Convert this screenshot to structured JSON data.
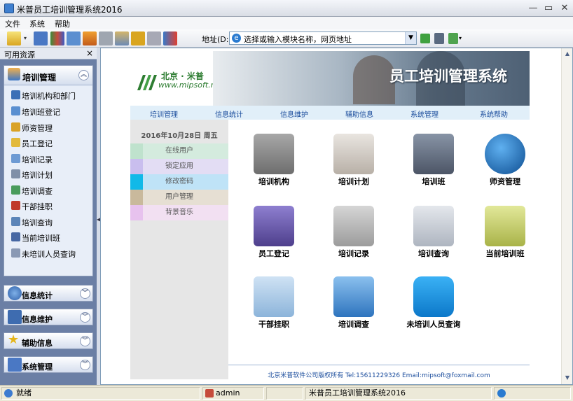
{
  "window": {
    "title": "米普员工培训管理系统2016",
    "minimize": "—",
    "restore": "▭",
    "close": "✕"
  },
  "menu": [
    "文件",
    "系统",
    "帮助"
  ],
  "toolbar": {
    "address_label": "地址(D:)",
    "address_value": "选择或输入模块名称，网页地址",
    "buttons": [
      "open-folder-icon",
      "list-view-icon",
      "books-icon",
      "data-icon",
      "home-icon",
      "print-icon",
      "tools-icon",
      "lock-icon",
      "user-lock-icon",
      "exit-icon"
    ]
  },
  "sidebar": {
    "title": "可用资源",
    "close": "×",
    "panel": {
      "label": "培训管理",
      "items": [
        {
          "label": "培训机构和部门",
          "color": "#3B6FB6"
        },
        {
          "label": "培训班登记",
          "color": "#5A8FD0"
        },
        {
          "label": "师资管理",
          "color": "#D9A227"
        },
        {
          "label": "员工登记",
          "color": "#E2B93B"
        },
        {
          "label": "培训记录",
          "color": "#6D9AD3"
        },
        {
          "label": "培训计划",
          "color": "#7F8FA8"
        },
        {
          "label": "培训调查",
          "color": "#4A9C5C"
        },
        {
          "label": "干部挂职",
          "color": "#C0392B"
        },
        {
          "label": "培训查询",
          "color": "#5B84B8"
        },
        {
          "label": "当前培训班",
          "color": "#4667A3"
        },
        {
          "label": "未培训人员查询",
          "color": "#8A99B4"
        }
      ]
    },
    "groups": [
      {
        "label": "信息统计",
        "color": "#4C7AC0"
      },
      {
        "label": "信息维护",
        "color": "#3E6CB0"
      },
      {
        "label": "辅助信息",
        "color": "#E5B51A"
      },
      {
        "label": "系统管理",
        "color": "#4A78C4"
      }
    ]
  },
  "banner": {
    "company_cn": "北京 · 米普",
    "company_url": "www.mipsoft.net",
    "system_title": "员工培训管理系统"
  },
  "topnav": [
    "培训管理",
    "信息统计",
    "信息维护",
    "辅助信息",
    "系统管理",
    "系统帮助"
  ],
  "leftcol": {
    "date": "2016年10月28日  周五",
    "buttons": [
      {
        "label": "在线用户",
        "bg": "#D4EBDE",
        "strip": "#BFE2CD"
      },
      {
        "label": "锁定应用",
        "bg": "#E3DDF4",
        "strip": "#C9BEEE"
      },
      {
        "label": "修改密码",
        "bg": "#BFE3F7",
        "strip": "#11B9E8"
      },
      {
        "label": "用户管理",
        "bg": "#E6DFD3",
        "strip": "#C9B99C"
      },
      {
        "label": "背景音乐",
        "bg": "#F2E0F2",
        "strip": "#E7C2EE"
      }
    ]
  },
  "tiles": [
    {
      "label": "培训机构",
      "icon": "home-folder-icon",
      "color": "#8C8C8C"
    },
    {
      "label": "培训计划",
      "icon": "calendar-clock-icon",
      "color": "#C9C3BC"
    },
    {
      "label": "培训班",
      "icon": "adobe-folder-icon",
      "color": "#5E6878"
    },
    {
      "label": "师资管理",
      "icon": "users-globe-icon",
      "color": "#1E6FB8"
    },
    {
      "label": "员工登记",
      "icon": "finder-folder-icon",
      "color": "#6A5AA8"
    },
    {
      "label": "培训记录",
      "icon": "people-folder-icon",
      "color": "#B7B7B7"
    },
    {
      "label": "培训查询",
      "icon": "id-search-icon",
      "color": "#C9CED6"
    },
    {
      "label": "当前培训班",
      "icon": "folder-clock-icon",
      "color": "#C7D06A"
    },
    {
      "label": "干部挂职",
      "icon": "star-folder-icon",
      "color": "#A9C9E6"
    },
    {
      "label": "培训调查",
      "icon": "pencil-folder-icon",
      "color": "#5A9AD5"
    },
    {
      "label": "未培训人员查询",
      "icon": "user-group-icon",
      "color": "#1B8FE0"
    }
  ],
  "footer": "北京米普软件公司版权所有   Tel:15611229326    Email:mipsoft@foxmail.com",
  "status": {
    "ready": "就绪",
    "user": "admin",
    "app": "米普员工培训管理系统2016"
  }
}
